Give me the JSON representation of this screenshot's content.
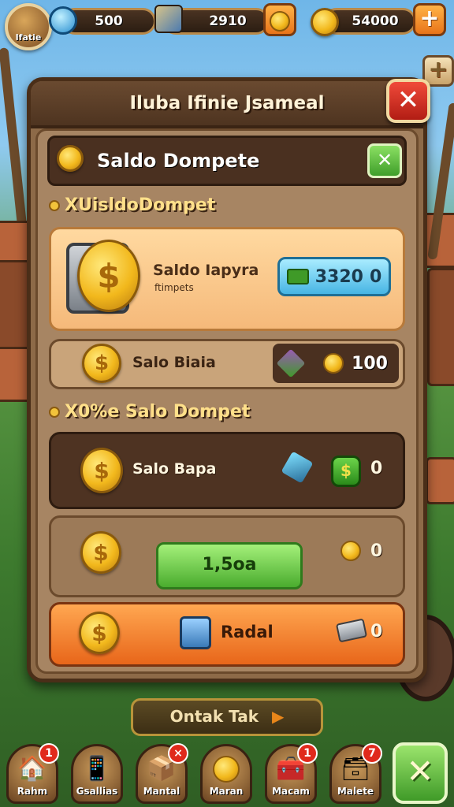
{
  "topbar": {
    "avatar_label": "Ifatie",
    "gems": "500",
    "energy": "2910",
    "coins": "54000",
    "plus_label": "+"
  },
  "panel": {
    "title": "Iluba Ifinie Jsameal",
    "close_label": "✕",
    "header": "Saldo Dompete",
    "header_close": "✕"
  },
  "section1": {
    "label": "XUisldoDompet",
    "card1_title": "Saldo Iapyra",
    "card1_subtitle": "ftimpets",
    "card1_value": "3320",
    "card1_value2": "0",
    "card2_label": "Salo Biaia",
    "card2_value": "100"
  },
  "section2": {
    "label": "X0%e Salo Dompet",
    "card3_label": "Salo Bapa",
    "card3_value": "0",
    "card4_button": "1,5oa",
    "card4_value": "0",
    "card5_label": "Radal",
    "card5_value": "0"
  },
  "contact_label": "Ontak Tak",
  "nav": [
    {
      "label": "Rahm",
      "badge": "1",
      "icon": "house-icon"
    },
    {
      "label": "Gsallias",
      "badge": "",
      "icon": "phone-icon"
    },
    {
      "label": "Mantal",
      "badge": "×",
      "icon": "box-icon"
    },
    {
      "label": "Maran",
      "badge": "",
      "icon": "coin-icon"
    },
    {
      "label": "Macam",
      "badge": "1",
      "icon": "chest-icon"
    },
    {
      "label": "Malete",
      "badge": "7",
      "icon": "crate-icon"
    }
  ],
  "colors": {
    "panel": "#8d6a48",
    "accent_orange": "#e8661a",
    "accent_green": "#4aac2e",
    "accent_blue": "#47b5e4",
    "danger": "#e02a1c"
  }
}
